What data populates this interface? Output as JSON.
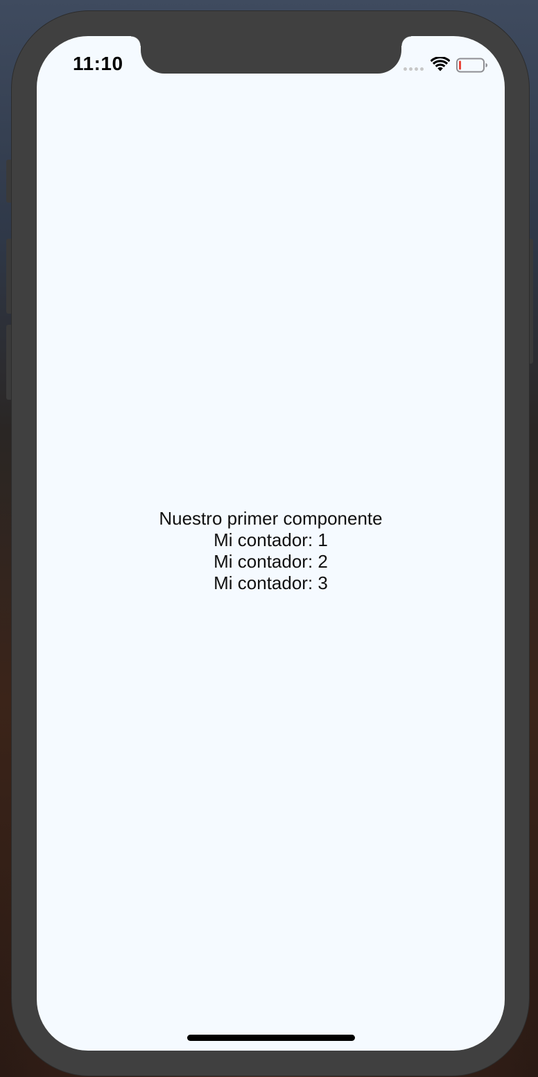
{
  "status_bar": {
    "time": "11:10",
    "icons": [
      "cellular-signal-icon",
      "wifi-icon",
      "battery-icon"
    ],
    "battery_level_fraction": 0.1,
    "battery_low_color": "#e8473b"
  },
  "main": {
    "title": "Nuestro primer componente",
    "counters": [
      "Mi contador: 1",
      "Mi contador: 2",
      "Mi contador: 3"
    ]
  },
  "colors": {
    "screen_background": "#f5faff",
    "device_frame": "#404040",
    "text": "#111111"
  }
}
